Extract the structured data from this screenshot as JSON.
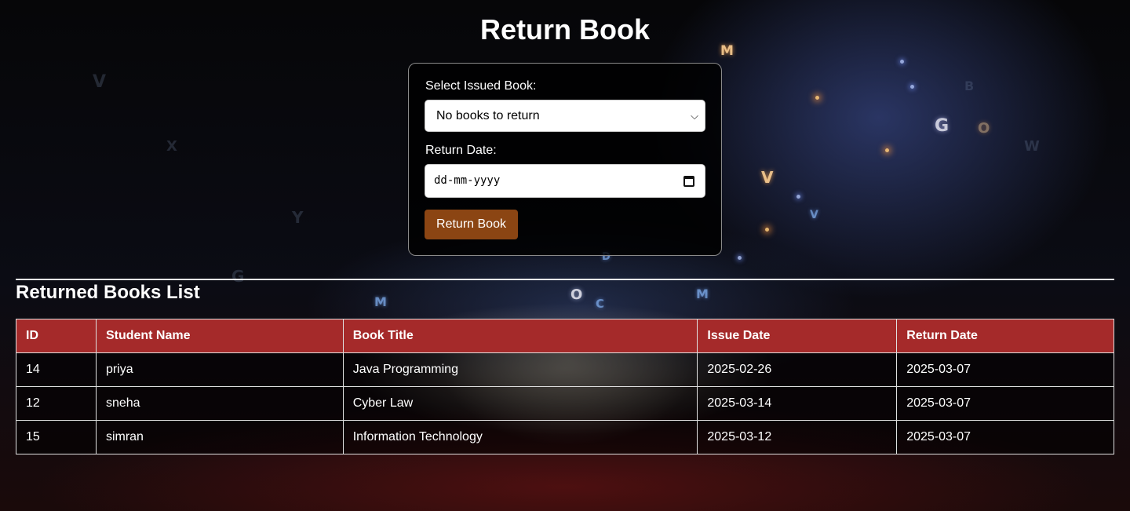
{
  "page": {
    "title": "Return Book"
  },
  "form": {
    "issued_book_label": "Select Issued Book:",
    "issued_book_value": "No books to return",
    "return_date_label": "Return Date:",
    "return_date_placeholder": "dd-mm-yyyy",
    "submit_label": "Return Book",
    "submit_color": "#8b4513"
  },
  "returned": {
    "title": "Returned Books List",
    "header_color": "#a52a2a",
    "columns": [
      "ID",
      "Student Name",
      "Book Title",
      "Issue Date",
      "Return Date"
    ],
    "rows": [
      [
        "14",
        "priya",
        "Java Programming",
        "2025-02-26",
        "2025-03-07"
      ],
      [
        "12",
        "sneha",
        "Cyber Law",
        "2025-03-14",
        "2025-03-07"
      ],
      [
        "15",
        "simran",
        "Information Technology",
        "2025-03-12",
        "2025-03-07"
      ]
    ]
  },
  "background": {
    "glyphs": [
      "M",
      "G",
      "V",
      "V",
      "W",
      "O",
      "M",
      "O",
      "C",
      "M",
      "D",
      "B",
      "V",
      "G",
      "X",
      "Y"
    ]
  }
}
